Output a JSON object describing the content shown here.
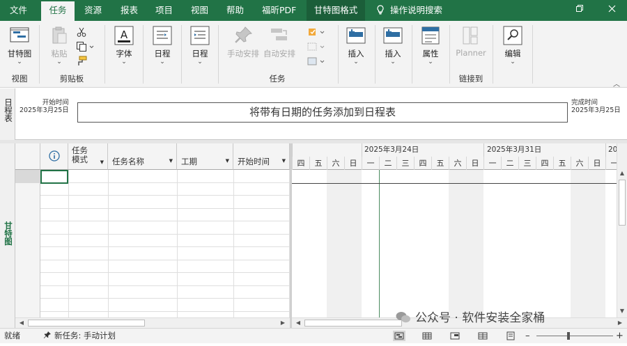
{
  "menu": {
    "tabs": [
      "文件",
      "任务",
      "资源",
      "报表",
      "项目",
      "视图",
      "帮助",
      "福昕PDF"
    ],
    "active_tab": "任务",
    "context_tab": "甘特图格式",
    "search": "操作说明搜索",
    "colors": {
      "brand": "#217346"
    }
  },
  "ribbon": {
    "view_group": {
      "label": "视图",
      "gantt_button": "甘特图"
    },
    "clipboard_group": {
      "label": "剪贴板",
      "paste": "粘贴"
    },
    "font_button": "字体",
    "schedule_button_1": "日程",
    "schedule_button_2": "日程",
    "tasks_group": {
      "label": "任务",
      "manual": "手动安排",
      "auto": "自动安排"
    },
    "insert_button_1": "插入",
    "insert_button_2": "插入",
    "properties_button": "属性",
    "planner_button": "Planner",
    "links_group_label": "链接到",
    "edit_button": "编辑"
  },
  "timeline": {
    "side_label": "日程表",
    "start_label": "开始时间",
    "start_date": "2025年3月25日",
    "finish_label": "完成时间",
    "finish_date": "2025年3月25日",
    "placeholder": "将带有日期的任务添加到日程表"
  },
  "gantt": {
    "side_label": "甘特图",
    "columns": {
      "info_icon": "info-icon",
      "task_mode_line1": "任务",
      "task_mode_line2": "模式",
      "task_name": "任务名称",
      "duration": "工期",
      "start": "开始时间"
    },
    "weeks": [
      "2025年3月24日",
      "2025年3月31日",
      "20"
    ],
    "days": [
      "四",
      "五",
      "六",
      "日",
      "一",
      "二",
      "三",
      "四",
      "五",
      "六",
      "日",
      "一",
      "二",
      "三",
      "四",
      "五",
      "六",
      "日",
      "一"
    ]
  },
  "status": {
    "ready": "就绪",
    "new_task": "新任务: 手动计划"
  },
  "watermark": "公众号 · 软件安装全家桶"
}
